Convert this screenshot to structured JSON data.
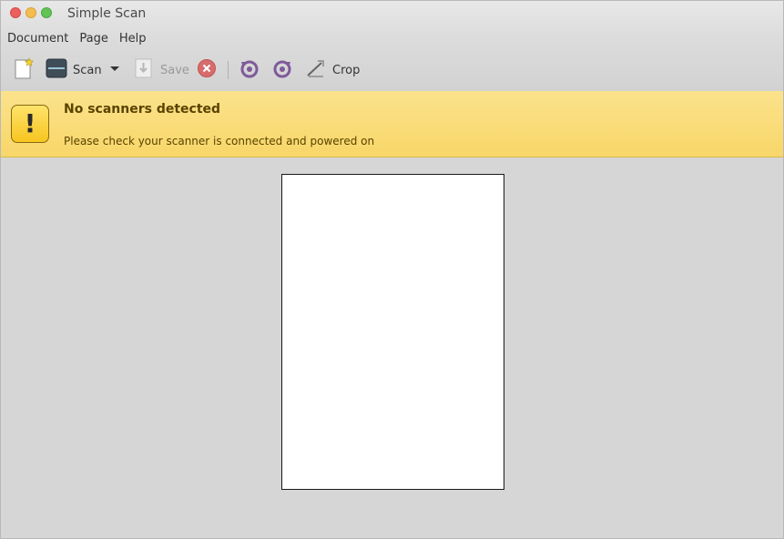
{
  "window": {
    "title": "Simple Scan"
  },
  "menu": {
    "items": [
      "Document",
      "Page",
      "Help"
    ]
  },
  "toolbar": {
    "scan_label": "Scan",
    "save_label": "Save",
    "crop_label": "Crop"
  },
  "infobar": {
    "title": "No scanners detected",
    "message": "Please check your scanner is connected and powered on",
    "icon_glyph": "!"
  },
  "colors": {
    "infobar_bg": "#f8d769",
    "close": "#ec5f5d",
    "minimize": "#f4bd4f",
    "maximize": "#61c455",
    "rotate_icons": "#7e5a9b"
  }
}
